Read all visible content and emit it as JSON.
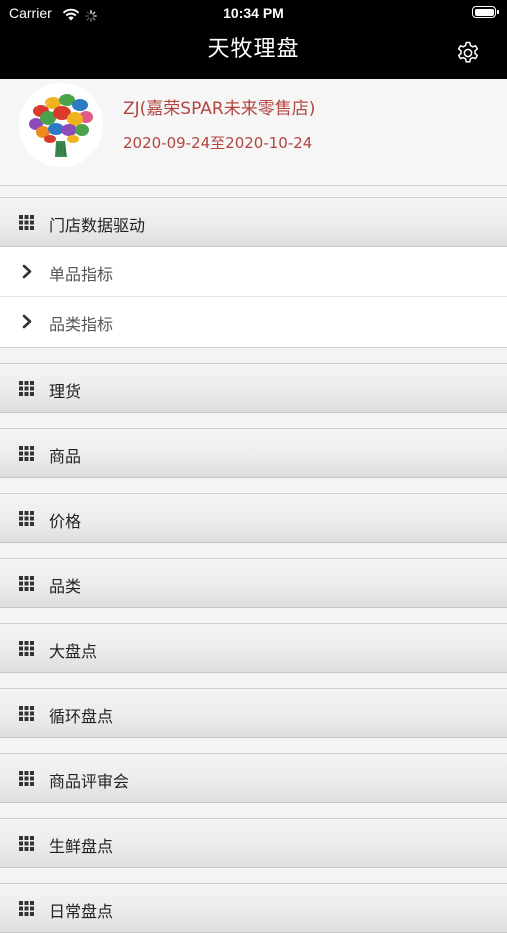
{
  "status_bar": {
    "carrier": "Carrier",
    "time": "10:34 PM"
  },
  "nav": {
    "title": "天牧理盘"
  },
  "store": {
    "name": "ZJ(嘉荣SPAR未来零售店)",
    "date_range": "2020-09-24至2020-10-24"
  },
  "menu": {
    "expanded_section": {
      "label": "门店数据驱动",
      "children": [
        {
          "label": "单品指标"
        },
        {
          "label": "品类指标"
        }
      ]
    },
    "sections": [
      {
        "label": "理货"
      },
      {
        "label": "商品"
      },
      {
        "label": "价格"
      },
      {
        "label": "品类"
      },
      {
        "label": "大盘点"
      },
      {
        "label": "循环盘点"
      },
      {
        "label": "商品评审会"
      },
      {
        "label": "生鲜盘点"
      },
      {
        "label": "日常盘点"
      }
    ]
  },
  "colors": {
    "nav_background": "#000000",
    "store_text": "#b3453f",
    "accent_section_text": "#222222"
  },
  "icons": {
    "settings": "gear-icon",
    "section": "grid-icon",
    "sub_item": "chevron-right-icon"
  }
}
